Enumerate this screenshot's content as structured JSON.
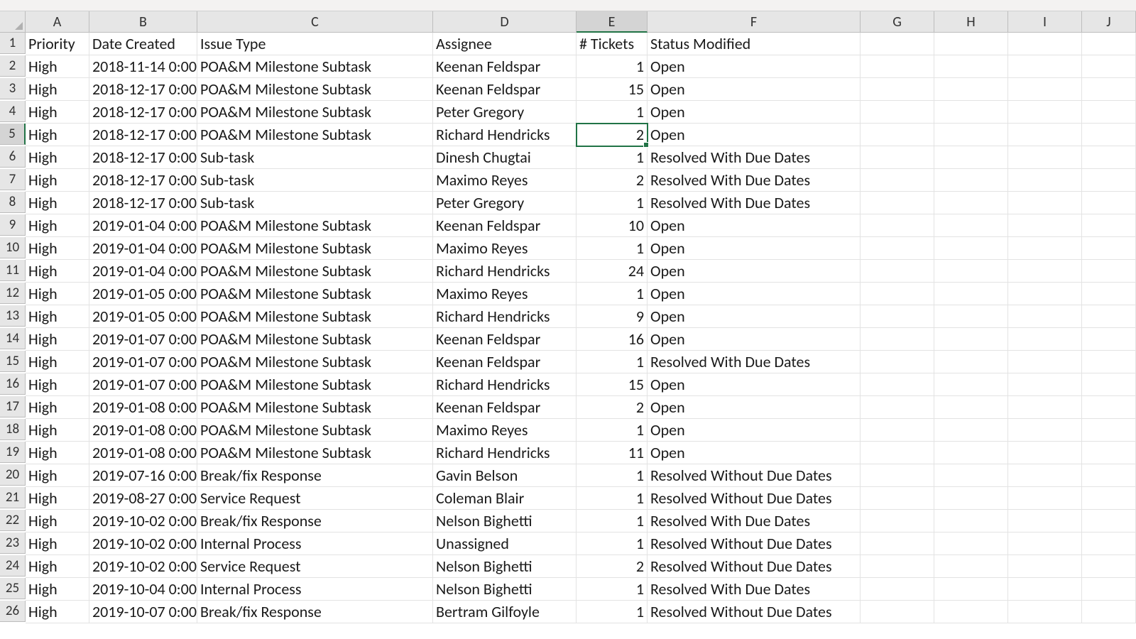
{
  "columns": [
    "A",
    "B",
    "C",
    "D",
    "E",
    "F",
    "G",
    "H",
    "I",
    "J"
  ],
  "activeColumnIndex": 4,
  "activeRowNumber": 5,
  "selected": {
    "row": 5,
    "col": 4
  },
  "headers": [
    "Priority",
    "Date Created",
    "Issue Type",
    "Assignee",
    "# Tickets",
    "Status Modified"
  ],
  "rows": [
    {
      "priority": "High",
      "date": "2018-11-14 0:00",
      "issue": "POA&M Milestone Subtask",
      "assignee": "Keenan Feldspar",
      "tickets": 1,
      "status": "Open"
    },
    {
      "priority": "High",
      "date": "2018-12-17 0:00",
      "issue": "POA&M Milestone Subtask",
      "assignee": "Keenan Feldspar",
      "tickets": 15,
      "status": "Open"
    },
    {
      "priority": "High",
      "date": "2018-12-17 0:00",
      "issue": "POA&M Milestone Subtask",
      "assignee": "Peter Gregory",
      "tickets": 1,
      "status": "Open"
    },
    {
      "priority": "High",
      "date": "2018-12-17 0:00",
      "issue": "POA&M Milestone Subtask",
      "assignee": "Richard Hendricks",
      "tickets": 2,
      "status": "Open"
    },
    {
      "priority": "High",
      "date": "2018-12-17 0:00",
      "issue": "Sub-task",
      "assignee": "Dinesh Chugtai",
      "tickets": 1,
      "status": "Resolved With Due Dates"
    },
    {
      "priority": "High",
      "date": "2018-12-17 0:00",
      "issue": "Sub-task",
      "assignee": "Maximo Reyes",
      "tickets": 2,
      "status": "Resolved With Due Dates"
    },
    {
      "priority": "High",
      "date": "2018-12-17 0:00",
      "issue": "Sub-task",
      "assignee": "Peter Gregory",
      "tickets": 1,
      "status": "Resolved With Due Dates"
    },
    {
      "priority": "High",
      "date": "2019-01-04 0:00",
      "issue": "POA&M Milestone Subtask",
      "assignee": "Keenan Feldspar",
      "tickets": 10,
      "status": "Open"
    },
    {
      "priority": "High",
      "date": "2019-01-04 0:00",
      "issue": "POA&M Milestone Subtask",
      "assignee": "Maximo Reyes",
      "tickets": 1,
      "status": "Open"
    },
    {
      "priority": "High",
      "date": "2019-01-04 0:00",
      "issue": "POA&M Milestone Subtask",
      "assignee": "Richard Hendricks",
      "tickets": 24,
      "status": "Open"
    },
    {
      "priority": "High",
      "date": "2019-01-05 0:00",
      "issue": "POA&M Milestone Subtask",
      "assignee": "Maximo Reyes",
      "tickets": 1,
      "status": "Open"
    },
    {
      "priority": "High",
      "date": "2019-01-05 0:00",
      "issue": "POA&M Milestone Subtask",
      "assignee": "Richard Hendricks",
      "tickets": 9,
      "status": "Open"
    },
    {
      "priority": "High",
      "date": "2019-01-07 0:00",
      "issue": "POA&M Milestone Subtask",
      "assignee": "Keenan Feldspar",
      "tickets": 16,
      "status": "Open"
    },
    {
      "priority": "High",
      "date": "2019-01-07 0:00",
      "issue": "POA&M Milestone Subtask",
      "assignee": "Keenan Feldspar",
      "tickets": 1,
      "status": "Resolved With Due Dates"
    },
    {
      "priority": "High",
      "date": "2019-01-07 0:00",
      "issue": "POA&M Milestone Subtask",
      "assignee": "Richard Hendricks",
      "tickets": 15,
      "status": "Open"
    },
    {
      "priority": "High",
      "date": "2019-01-08 0:00",
      "issue": "POA&M Milestone Subtask",
      "assignee": "Keenan Feldspar",
      "tickets": 2,
      "status": "Open"
    },
    {
      "priority": "High",
      "date": "2019-01-08 0:00",
      "issue": "POA&M Milestone Subtask",
      "assignee": "Maximo Reyes",
      "tickets": 1,
      "status": "Open"
    },
    {
      "priority": "High",
      "date": "2019-01-08 0:00",
      "issue": "POA&M Milestone Subtask",
      "assignee": "Richard Hendricks",
      "tickets": 11,
      "status": "Open"
    },
    {
      "priority": "High",
      "date": "2019-07-16 0:00",
      "issue": "Break/fix Response",
      "assignee": "Gavin Belson",
      "tickets": 1,
      "status": "Resolved Without Due Dates"
    },
    {
      "priority": "High",
      "date": "2019-08-27 0:00",
      "issue": "Service Request",
      "assignee": "Coleman Blair",
      "tickets": 1,
      "status": "Resolved Without Due Dates"
    },
    {
      "priority": "High",
      "date": "2019-10-02 0:00",
      "issue": "Break/fix Response",
      "assignee": "Nelson Bighetti",
      "tickets": 1,
      "status": "Resolved With Due Dates"
    },
    {
      "priority": "High",
      "date": "2019-10-02 0:00",
      "issue": "Internal Process",
      "assignee": "Unassigned",
      "tickets": 1,
      "status": "Resolved Without Due Dates"
    },
    {
      "priority": "High",
      "date": "2019-10-02 0:00",
      "issue": "Service Request",
      "assignee": "Nelson Bighetti",
      "tickets": 2,
      "status": "Resolved Without Due Dates"
    },
    {
      "priority": "High",
      "date": "2019-10-04 0:00",
      "issue": "Internal Process",
      "assignee": "Nelson Bighetti",
      "tickets": 1,
      "status": "Resolved With Due Dates"
    },
    {
      "priority": "High",
      "date": "2019-10-07 0:00",
      "issue": "Break/fix Response",
      "assignee": "Bertram Gilfoyle",
      "tickets": 1,
      "status": "Resolved Without Due Dates"
    }
  ],
  "chart_data": {
    "type": "table",
    "title": "",
    "columns": [
      "Priority",
      "Date Created",
      "Issue Type",
      "Assignee",
      "# Tickets",
      "Status Modified"
    ],
    "data": [
      [
        "High",
        "2018-11-14 0:00",
        "POA&M Milestone Subtask",
        "Keenan Feldspar",
        1,
        "Open"
      ],
      [
        "High",
        "2018-12-17 0:00",
        "POA&M Milestone Subtask",
        "Keenan Feldspar",
        15,
        "Open"
      ],
      [
        "High",
        "2018-12-17 0:00",
        "POA&M Milestone Subtask",
        "Peter Gregory",
        1,
        "Open"
      ],
      [
        "High",
        "2018-12-17 0:00",
        "POA&M Milestone Subtask",
        "Richard Hendricks",
        2,
        "Open"
      ],
      [
        "High",
        "2018-12-17 0:00",
        "Sub-task",
        "Dinesh Chugtai",
        1,
        "Resolved With Due Dates"
      ],
      [
        "High",
        "2018-12-17 0:00",
        "Sub-task",
        "Maximo Reyes",
        2,
        "Resolved With Due Dates"
      ],
      [
        "High",
        "2018-12-17 0:00",
        "Sub-task",
        "Peter Gregory",
        1,
        "Resolved With Due Dates"
      ],
      [
        "High",
        "2019-01-04 0:00",
        "POA&M Milestone Subtask",
        "Keenan Feldspar",
        10,
        "Open"
      ],
      [
        "High",
        "2019-01-04 0:00",
        "POA&M Milestone Subtask",
        "Maximo Reyes",
        1,
        "Open"
      ],
      [
        "High",
        "2019-01-04 0:00",
        "POA&M Milestone Subtask",
        "Richard Hendricks",
        24,
        "Open"
      ],
      [
        "High",
        "2019-01-05 0:00",
        "POA&M Milestone Subtask",
        "Maximo Reyes",
        1,
        "Open"
      ],
      [
        "High",
        "2019-01-05 0:00",
        "POA&M Milestone Subtask",
        "Richard Hendricks",
        9,
        "Open"
      ],
      [
        "High",
        "2019-01-07 0:00",
        "POA&M Milestone Subtask",
        "Keenan Feldspar",
        16,
        "Open"
      ],
      [
        "High",
        "2019-01-07 0:00",
        "POA&M Milestone Subtask",
        "Keenan Feldspar",
        1,
        "Resolved With Due Dates"
      ],
      [
        "High",
        "2019-01-07 0:00",
        "POA&M Milestone Subtask",
        "Richard Hendricks",
        15,
        "Open"
      ],
      [
        "High",
        "2019-01-08 0:00",
        "POA&M Milestone Subtask",
        "Keenan Feldspar",
        2,
        "Open"
      ],
      [
        "High",
        "2019-01-08 0:00",
        "POA&M Milestone Subtask",
        "Maximo Reyes",
        1,
        "Open"
      ],
      [
        "High",
        "2019-01-08 0:00",
        "POA&M Milestone Subtask",
        "Richard Hendricks",
        11,
        "Open"
      ],
      [
        "High",
        "2019-07-16 0:00",
        "Break/fix Response",
        "Gavin Belson",
        1,
        "Resolved Without Due Dates"
      ],
      [
        "High",
        "2019-08-27 0:00",
        "Service Request",
        "Coleman Blair",
        1,
        "Resolved Without Due Dates"
      ],
      [
        "High",
        "2019-10-02 0:00",
        "Break/fix Response",
        "Nelson Bighetti",
        1,
        "Resolved With Due Dates"
      ],
      [
        "High",
        "2019-10-02 0:00",
        "Internal Process",
        "Unassigned",
        1,
        "Resolved Without Due Dates"
      ],
      [
        "High",
        "2019-10-02 0:00",
        "Service Request",
        "Nelson Bighetti",
        2,
        "Resolved Without Due Dates"
      ],
      [
        "High",
        "2019-10-04 0:00",
        "Internal Process",
        "Nelson Bighetti",
        1,
        "Resolved With Due Dates"
      ],
      [
        "High",
        "2019-10-07 0:00",
        "Break/fix Response",
        "Bertram Gilfoyle",
        1,
        "Resolved Without Due Dates"
      ]
    ]
  }
}
